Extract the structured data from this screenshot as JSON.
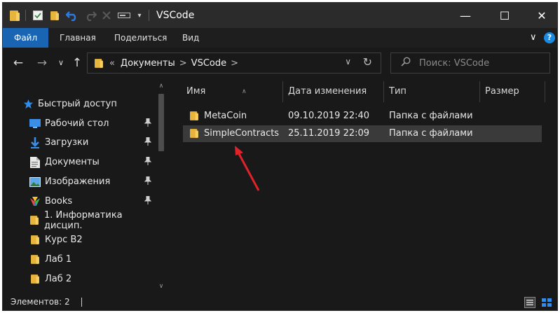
{
  "window": {
    "title": "VSCode",
    "minimize_glyph": "—",
    "maximize_glyph": "☐",
    "close_glyph": "✕"
  },
  "ribbon": {
    "tabs": [
      {
        "label": "Файл",
        "active": true
      },
      {
        "label": "Главная",
        "active": false
      },
      {
        "label": "Поделиться",
        "active": false
      },
      {
        "label": "Вид",
        "active": false
      }
    ],
    "expand_glyph": "∨",
    "help_glyph": "?"
  },
  "address": {
    "overflow": "«",
    "segments": [
      "Документы",
      "VSCode"
    ],
    "separator": ">",
    "dropdown_glyph": "∨",
    "refresh_glyph": "↻"
  },
  "search": {
    "placeholder": "Поиск: VSCode"
  },
  "nav": {
    "back": "←",
    "forward": "→",
    "recent": "∨",
    "up": "↑"
  },
  "sidebar": {
    "items": [
      {
        "label": "Быстрый доступ",
        "icon": "star-icon",
        "pinned": false,
        "indent": false
      },
      {
        "label": "Рабочий стол",
        "icon": "desktop-icon",
        "pinned": true,
        "indent": true
      },
      {
        "label": "Загрузки",
        "icon": "download-icon",
        "pinned": true,
        "indent": true
      },
      {
        "label": "Документы",
        "icon": "documents-icon",
        "pinned": true,
        "indent": true
      },
      {
        "label": "Изображения",
        "icon": "pictures-icon",
        "pinned": true,
        "indent": true
      },
      {
        "label": "Books",
        "icon": "books-icon",
        "pinned": true,
        "indent": true
      },
      {
        "label": "1. Информатика дисцип.",
        "icon": "folder-icon",
        "pinned": false,
        "indent": true
      },
      {
        "label": "Курс В2",
        "icon": "folder-icon",
        "pinned": false,
        "indent": true
      },
      {
        "label": "Лаб 1",
        "icon": "folder-icon",
        "pinned": false,
        "indent": true
      },
      {
        "label": "Лаб 2",
        "icon": "folder-icon",
        "pinned": false,
        "indent": true
      }
    ],
    "pin_glyph": "📌"
  },
  "table": {
    "columns": [
      "Имя",
      "Дата изменения",
      "Тип",
      "Размер"
    ],
    "rows": [
      {
        "name": "MetaCoin",
        "date": "09.10.2019 22:40",
        "type": "Папка с файлами",
        "size": "",
        "selected": false
      },
      {
        "name": "SimpleContracts",
        "date": "25.11.2019 22:09",
        "type": "Папка с файлами",
        "size": "",
        "selected": true
      }
    ]
  },
  "status": {
    "text": "Элементов: 2"
  },
  "colors": {
    "accent": "#1a64b4",
    "arrow": "#e0232b",
    "folder": "#e8b53c"
  }
}
